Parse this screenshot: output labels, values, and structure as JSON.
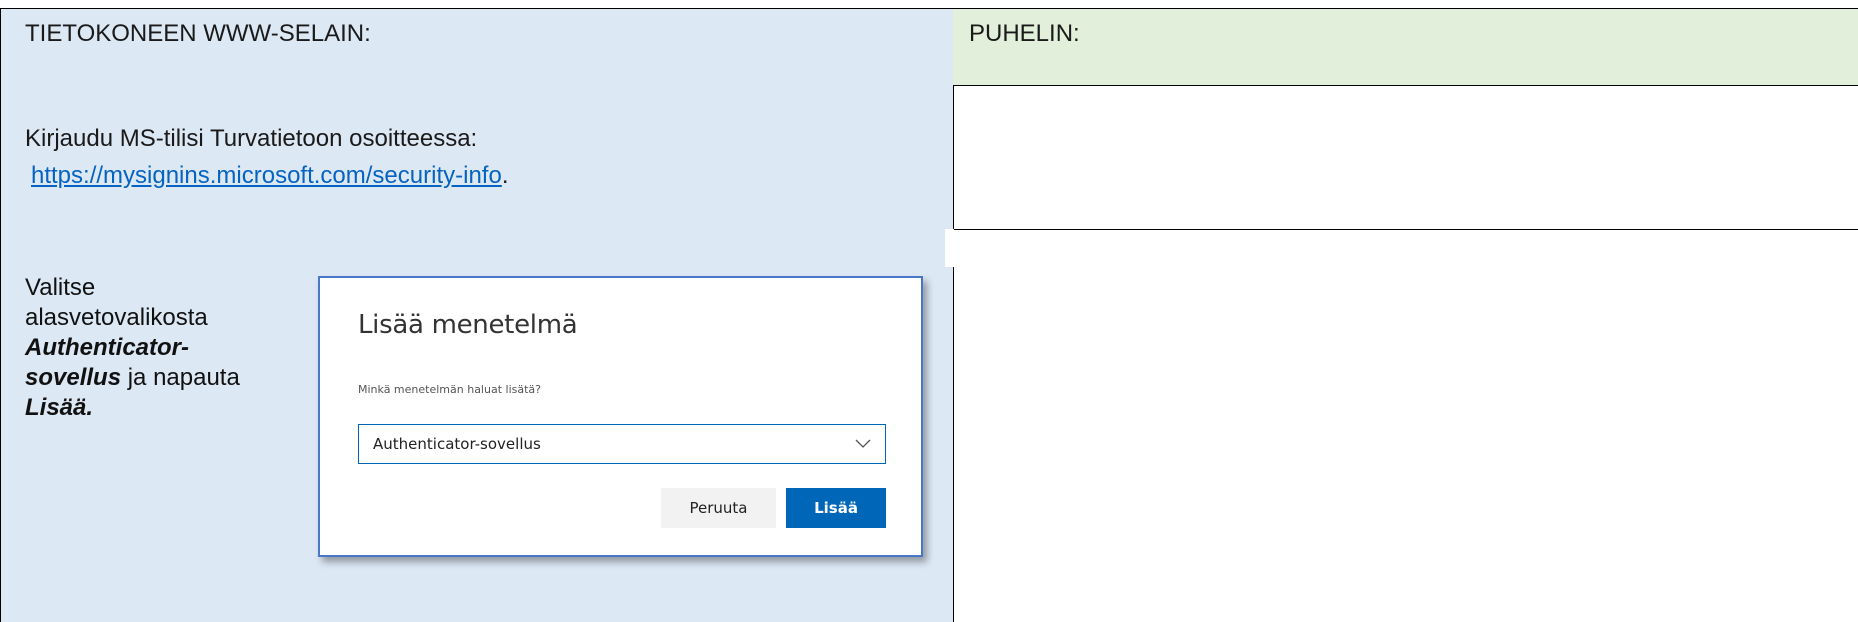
{
  "table": {
    "header_left": "TIETOKONEEN WWW-SELAIN:",
    "header_right": "PUHELIN:",
    "row1": {
      "text_line1": "Kirjaudu MS-tilisi Turvatietoon osoitteessa:",
      "link": "https://mysignins.microsoft.com/security-info",
      "link_trailing": "."
    },
    "row2": {
      "instr_line1": "Valitse",
      "instr_line2": "alasvetovalikosta",
      "instr_bold1": "Authenticator-",
      "instr_bold2": "sovellus",
      "instr_rest": " ja napauta",
      "instr_bold3": "Lisää."
    }
  },
  "dialog": {
    "title": "Lisää menetelmä",
    "question": "Minkä menetelmän haluat lisätä?",
    "selected_option": "Authenticator-sovellus",
    "cancel_label": "Peruuta",
    "add_label": "Lisää"
  },
  "colors": {
    "left_column_bg": "#dde8f5",
    "right_header_bg": "#e2efda",
    "link": "#0563c1",
    "primary_button": "#0067b8"
  }
}
